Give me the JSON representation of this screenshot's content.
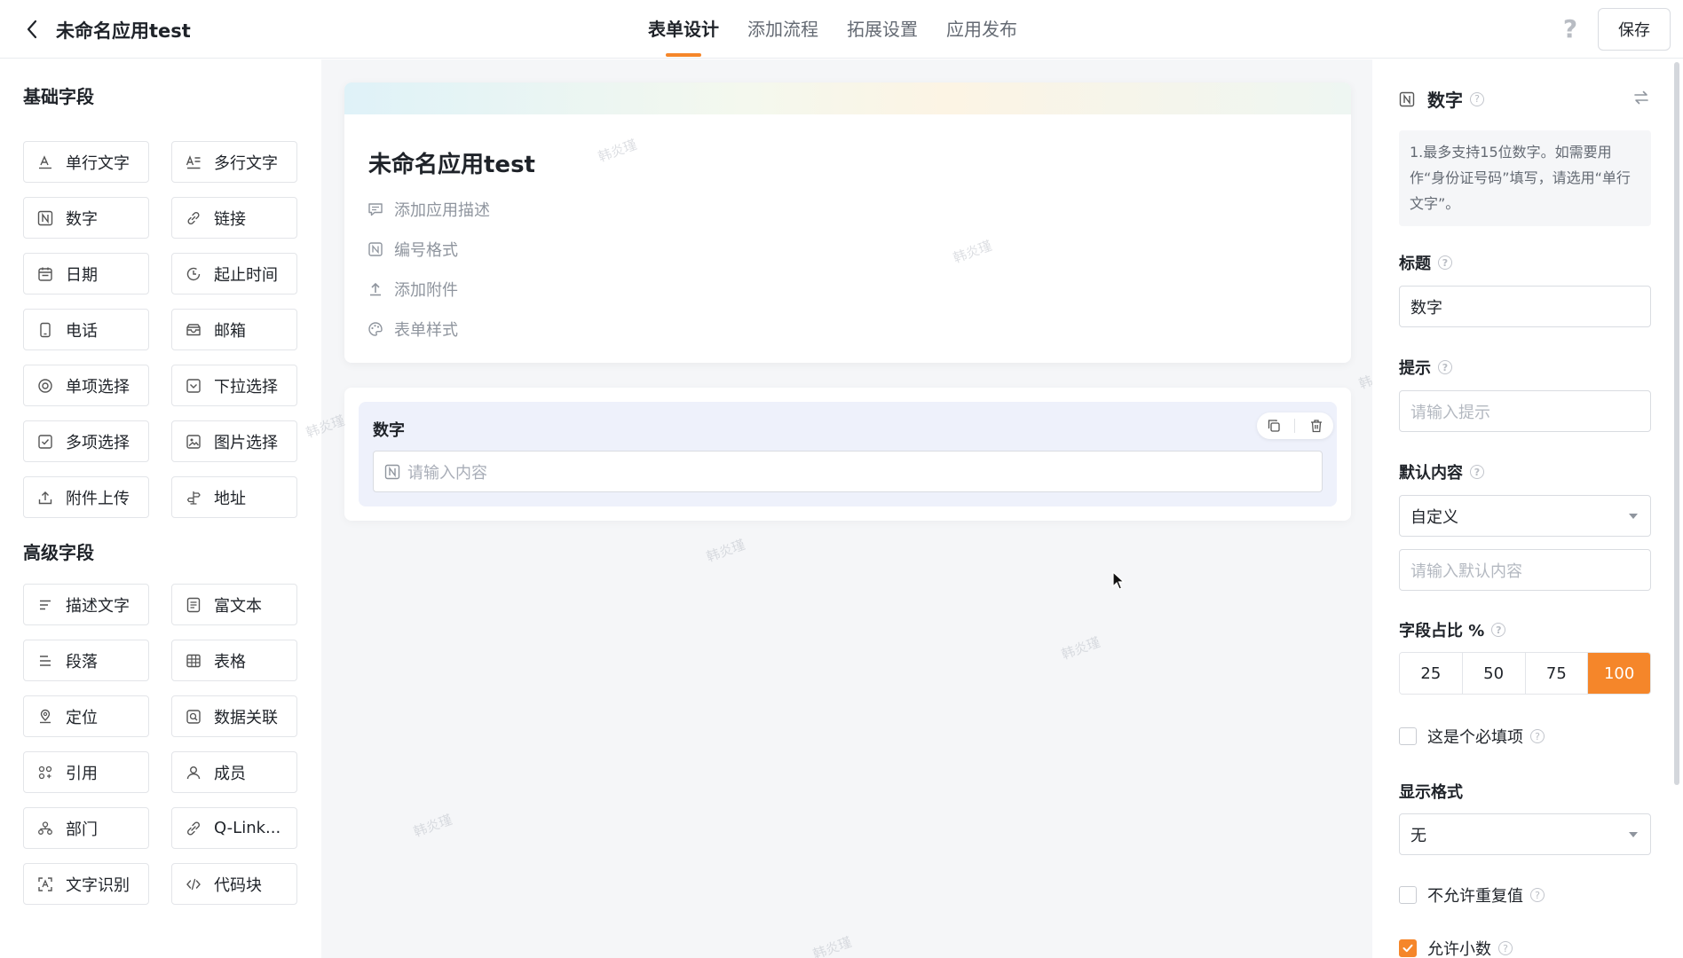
{
  "header": {
    "app_title": "未命名应用test",
    "tabs": [
      {
        "label": "表单设计",
        "active": true
      },
      {
        "label": "添加流程",
        "active": false
      },
      {
        "label": "拓展设置",
        "active": false
      },
      {
        "label": "应用发布",
        "active": false
      }
    ],
    "help_label": "?",
    "save_label": "保存"
  },
  "palette": {
    "basic_title": "基础字段",
    "basic_fields": [
      {
        "label": "单行文字",
        "icon": "single-line-text-icon"
      },
      {
        "label": "多行文字",
        "icon": "multi-line-text-icon"
      },
      {
        "label": "数字",
        "icon": "number-icon"
      },
      {
        "label": "链接",
        "icon": "link-icon"
      },
      {
        "label": "日期",
        "icon": "calendar-icon"
      },
      {
        "label": "起止时间",
        "icon": "time-range-icon"
      },
      {
        "label": "电话",
        "icon": "phone-icon"
      },
      {
        "label": "邮箱",
        "icon": "mail-icon"
      },
      {
        "label": "单项选择",
        "icon": "radio-icon"
      },
      {
        "label": "下拉选择",
        "icon": "dropdown-icon"
      },
      {
        "label": "多项选择",
        "icon": "checkbox-icon"
      },
      {
        "label": "图片选择",
        "icon": "image-icon"
      },
      {
        "label": "附件上传",
        "icon": "upload-icon"
      },
      {
        "label": "地址",
        "icon": "address-icon"
      }
    ],
    "advanced_title": "高级字段",
    "advanced_fields": [
      {
        "label": "描述文字",
        "icon": "description-icon"
      },
      {
        "label": "富文本",
        "icon": "rich-text-icon"
      },
      {
        "label": "段落",
        "icon": "paragraph-icon"
      },
      {
        "label": "表格",
        "icon": "table-icon"
      },
      {
        "label": "定位",
        "icon": "location-icon"
      },
      {
        "label": "数据关联",
        "icon": "data-link-icon"
      },
      {
        "label": "引用",
        "icon": "reference-icon"
      },
      {
        "label": "成员",
        "icon": "member-icon"
      },
      {
        "label": "部门",
        "icon": "department-icon"
      },
      {
        "label": "Q-Link...",
        "icon": "qlink-icon"
      },
      {
        "label": "文字识别",
        "icon": "ocr-icon"
      },
      {
        "label": "代码块",
        "icon": "code-icon"
      }
    ]
  },
  "canvas": {
    "form_title": "未命名应用test",
    "meta": [
      {
        "label": "添加应用描述",
        "icon": "comment-icon"
      },
      {
        "label": "编号格式",
        "icon": "number-format-icon"
      },
      {
        "label": "添加附件",
        "icon": "upload-icon"
      },
      {
        "label": "表单样式",
        "icon": "palette-icon"
      }
    ],
    "field": {
      "label": "数字",
      "placeholder": "请输入内容"
    },
    "watermark": "韩炎瑾"
  },
  "properties": {
    "type_title": "数字",
    "tip": "1.最多支持15位数字。如需要用作“身份证号码”填写，请选用“单行文字”。",
    "title_label": "标题",
    "title_value": "数字",
    "hint_label": "提示",
    "hint_placeholder": "请输入提示",
    "default_label": "默认内容",
    "default_select": "自定义",
    "default_placeholder": "请输入默认内容",
    "ratio_label": "字段占比 %",
    "ratio_options": [
      {
        "label": "25",
        "active": false
      },
      {
        "label": "50",
        "active": false
      },
      {
        "label": "75",
        "active": false
      },
      {
        "label": "100",
        "active": true
      }
    ],
    "required_label": "这是个必填项",
    "required_checked": false,
    "display_label": "显示格式",
    "display_value": "无",
    "no_duplicate_label": "不允许重复值",
    "no_duplicate_checked": false,
    "allow_decimal_label": "允许小数",
    "allow_decimal_checked": true
  },
  "colors": {
    "accent": "#f5862a",
    "canvas_bg": "#f5f6f8",
    "selected_field_bg": "#eef1fb",
    "text_primary": "#1f2329",
    "text_secondary": "#646a73"
  }
}
